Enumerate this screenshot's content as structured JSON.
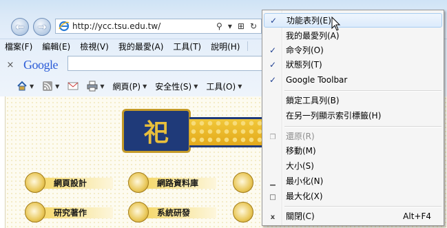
{
  "browser": {
    "address": {
      "url": "http://ycc.tsu.edu.tw/"
    },
    "menubar": [
      "檔案(F)",
      "編輯(E)",
      "檢視(V)",
      "我的最愛(A)",
      "工具(T)",
      "說明(H)"
    ],
    "googlebar": {
      "close": "×",
      "logo": "Google"
    },
    "commandbar": [
      {
        "icon": "home-icon",
        "label": ""
      },
      {
        "icon": "rss-feed-icon",
        "label": ""
      },
      {
        "icon": "mail-icon",
        "label": ""
      },
      {
        "icon": "print-icon",
        "label": ""
      },
      {
        "icon": "",
        "label": "網頁(P)"
      },
      {
        "icon": "",
        "label": "安全性(S)"
      },
      {
        "icon": "",
        "label": "工具(O)"
      }
    ]
  },
  "page": {
    "logo_glyph": "祀",
    "nav": [
      "網頁設計",
      "網路資料庫",
      "研究著作",
      "系統研發"
    ]
  },
  "context_menu": {
    "items": [
      {
        "label": "功能表列(E)",
        "checked": true,
        "highlighted": true
      },
      {
        "label": "我的最愛列(A)",
        "checked": false
      },
      {
        "label": "命令列(O)",
        "checked": true
      },
      {
        "label": "狀態列(T)",
        "checked": true
      },
      {
        "label": "Google Toolbar",
        "checked": true
      }
    ],
    "items2": [
      {
        "label": "鎖定工具列(B)"
      },
      {
        "label": "在另一列顯示索引標籤(H)"
      }
    ],
    "window_items": [
      {
        "label": "還原(R)",
        "disabled": true,
        "glyph": "❐"
      },
      {
        "label": "移動(M)",
        "glyph": ""
      },
      {
        "label": "大小(S)",
        "glyph": ""
      },
      {
        "label": "最小化(N)",
        "glyph": "▁"
      },
      {
        "label": "最大化(X)",
        "glyph": "□"
      }
    ],
    "close": {
      "label": "關閉(C)",
      "glyph": "x",
      "accel": "Alt+F4"
    }
  }
}
